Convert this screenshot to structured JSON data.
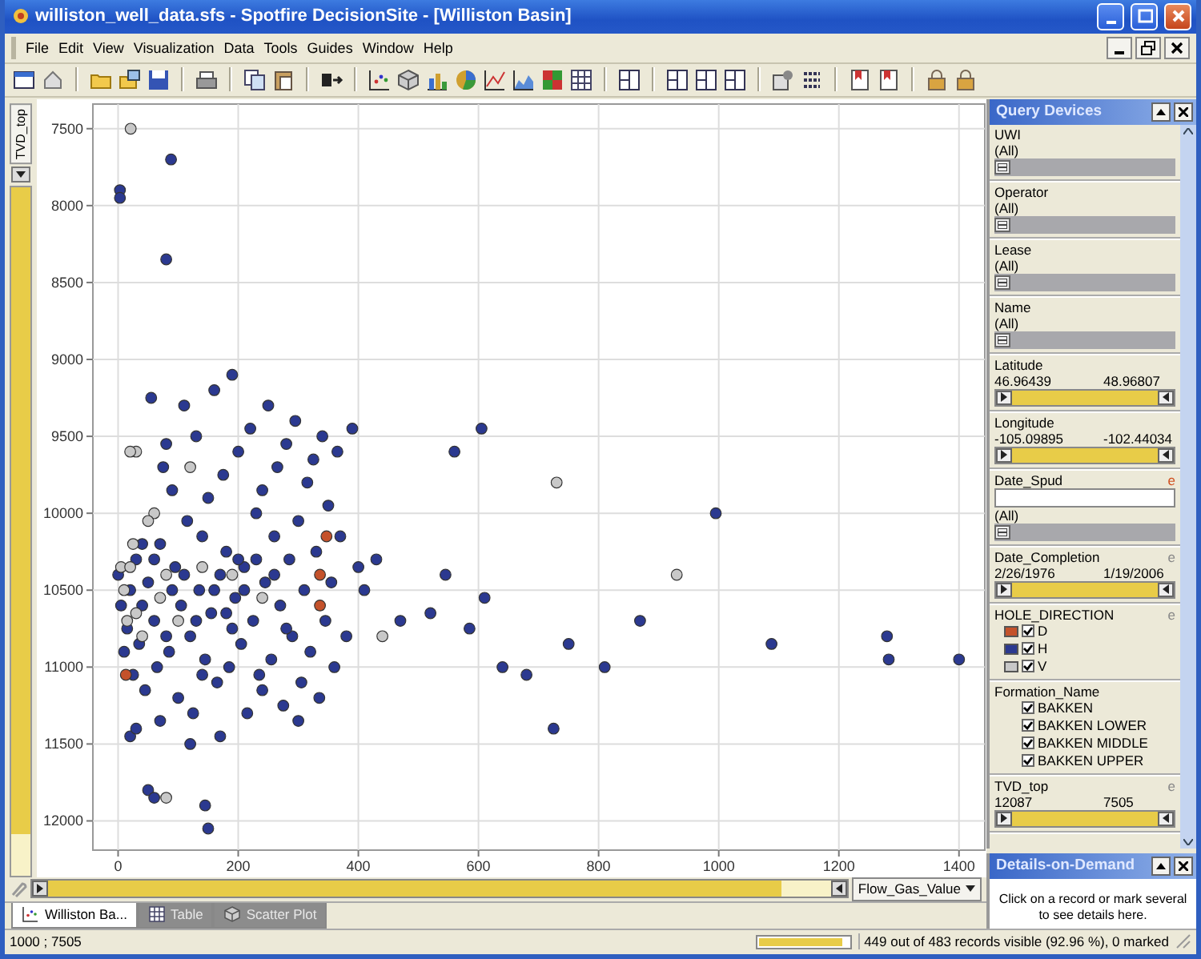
{
  "window": {
    "title": "williston_well_data.sfs - Spotfire DecisionSite - [Williston Basin]"
  },
  "menu": [
    "File",
    "Edit",
    "View",
    "Visualization",
    "Data",
    "Tools",
    "Guides",
    "Window",
    "Help"
  ],
  "y_axis": {
    "column": "TVD_top",
    "level": 0.94
  },
  "chart_data": {
    "type": "scatter",
    "grid": true,
    "xlim": [
      -42,
      1443
    ],
    "ylim": [
      12190,
      7340
    ],
    "xticks": [
      0,
      200,
      400,
      600,
      800,
      1000,
      1200,
      1400
    ],
    "yticks": [
      7500,
      8000,
      8500,
      9000,
      9500,
      10000,
      10500,
      11000,
      11500,
      12000
    ],
    "series": [
      {
        "color": "#2b3990",
        "x": [
          3,
          3,
          88,
          80,
          995,
          1400,
          1280,
          1283,
          1088,
          869,
          810,
          725,
          680,
          750,
          605,
          560,
          610,
          585,
          640,
          545,
          520,
          470,
          430,
          410,
          20,
          30,
          50,
          60,
          145,
          150,
          0,
          5,
          10,
          15,
          20,
          25,
          30,
          35,
          40,
          45,
          50,
          55,
          60,
          65,
          70,
          75,
          80,
          85,
          90,
          95,
          100,
          105,
          110,
          115,
          120,
          125,
          130,
          135,
          140,
          145,
          150,
          155,
          160,
          165,
          170,
          175,
          180,
          185,
          190,
          195,
          200,
          205,
          210,
          215,
          220,
          225,
          230,
          235,
          240,
          245,
          250,
          255,
          260,
          265,
          270,
          275,
          280,
          285,
          290,
          295,
          300,
          305,
          310,
          315,
          320,
          325,
          330,
          335,
          340,
          345,
          350,
          355,
          360,
          365,
          370,
          380,
          390,
          400,
          60,
          110,
          160,
          210,
          260,
          130,
          80,
          180,
          230,
          280,
          40,
          90,
          140,
          190,
          240,
          120,
          170,
          70,
          300,
          200
        ],
        "values": [
          7900,
          7950,
          7700,
          8350,
          10000,
          10950,
          10800,
          10950,
          10850,
          10700,
          11000,
          11400,
          11050,
          10850,
          9450,
          9600,
          10550,
          10750,
          11000,
          10400,
          10650,
          10700,
          10300,
          10500,
          11450,
          11400,
          11800,
          11850,
          11900,
          12050,
          10400,
          10600,
          10900,
          10750,
          10500,
          11050,
          10300,
          10850,
          10600,
          11150,
          10450,
          9250,
          10700,
          11000,
          10200,
          9700,
          9550,
          10900,
          9850,
          10350,
          11200,
          10600,
          9300,
          10050,
          10800,
          11300,
          9500,
          10500,
          10150,
          10950,
          9900,
          10650,
          9200,
          11100,
          10400,
          9750,
          10250,
          11000,
          9100,
          10550,
          9600,
          10850,
          10350,
          11300,
          9450,
          10700,
          10000,
          11050,
          9850,
          10450,
          9300,
          10950,
          10150,
          9700,
          10600,
          11250,
          9550,
          10300,
          10800,
          9400,
          10050,
          11100,
          10500,
          9800,
          10900,
          9650,
          10250,
          11200,
          9500,
          10700,
          9950,
          10450,
          11000,
          9600,
          10150,
          10800,
          9450,
          10350,
          10300,
          10400,
          10500,
          10500,
          10400,
          10700,
          10800,
          10650,
          10300,
          10750,
          10200,
          10500,
          11050,
          10750,
          11150,
          11500,
          11450,
          11350,
          11350,
          10300
        ]
      },
      {
        "color": "#c8c8c8",
        "x": [
          21,
          930,
          730,
          440,
          80,
          5,
          10,
          20,
          30,
          40,
          60,
          25,
          80,
          100,
          120,
          140,
          190,
          240,
          30,
          20,
          50,
          15,
          70
        ],
        "values": [
          7500,
          10400,
          9800,
          10800,
          11850,
          10350,
          10500,
          10350,
          10650,
          10800,
          10000,
          10200,
          10400,
          10700,
          9700,
          10350,
          10400,
          10550,
          9600,
          9600,
          10050,
          10700,
          10550
        ]
      },
      {
        "color": "#c4522b",
        "x": [
          13,
          347,
          336,
          336
        ],
        "values": [
          11050,
          10150,
          10400,
          10600
        ]
      }
    ]
  },
  "x_axis": {
    "column": "Flow_Gas_Value",
    "level": 0.92
  },
  "tabs": [
    {
      "label": "Williston Ba...",
      "selected": true
    },
    {
      "label": "Table",
      "selected": false
    },
    {
      "label": "Scatter Plot",
      "selected": false
    }
  ],
  "query_devices": {
    "title": "Query Devices",
    "devices": [
      {
        "kind": "item",
        "name": "UWI",
        "value": "(All)",
        "level": 0
      },
      {
        "kind": "item",
        "name": "Operator",
        "value": "(All)",
        "level": 0
      },
      {
        "kind": "item",
        "name": "Lease",
        "value": "(All)",
        "level": 0
      },
      {
        "kind": "item",
        "name": "Name",
        "value": "(All)",
        "level": 0
      },
      {
        "kind": "range",
        "name": "Latitude",
        "min": "46.96439",
        "max": "48.96807",
        "level": 1
      },
      {
        "kind": "range",
        "name": "Longitude",
        "min": "-105.09895",
        "max": "-102.44034",
        "level": 1
      },
      {
        "kind": "search",
        "name": "Date_Spud",
        "value": "(All)",
        "flag": "e",
        "flag_active": true,
        "level": 0
      },
      {
        "kind": "range",
        "name": "Date_Completion",
        "min": "2/26/1976",
        "max": "1/19/2006",
        "flag": "e",
        "flag_active": false,
        "level": 1
      },
      {
        "kind": "checkboxes",
        "name": "HOLE_DIRECTION",
        "flag": "e",
        "flag_active": false,
        "options": [
          {
            "label": "D",
            "checked": true,
            "color": "#c4522b"
          },
          {
            "label": "H",
            "checked": true,
            "color": "#2b3990"
          },
          {
            "label": "V",
            "checked": true,
            "color": "#c8c8c8"
          }
        ]
      },
      {
        "kind": "checkboxes",
        "name": "Formation_Name",
        "options": [
          {
            "label": "BAKKEN",
            "checked": true
          },
          {
            "label": "BAKKEN LOWER",
            "checked": true
          },
          {
            "label": "BAKKEN MIDDLE",
            "checked": true
          },
          {
            "label": "BAKKEN UPPER",
            "checked": true
          }
        ]
      },
      {
        "kind": "range",
        "name": "TVD_top",
        "min": "12087",
        "max": "7505",
        "flag": "e",
        "flag_active": false,
        "level": 1
      }
    ]
  },
  "details": {
    "title": "Details-on-Demand",
    "message": "Click on a record or mark several to see details here."
  },
  "status": {
    "coords": "1000 ; 7505",
    "level": 0.93,
    "records": "449 out of 483 records visible (92.96 %), 0 marked"
  }
}
